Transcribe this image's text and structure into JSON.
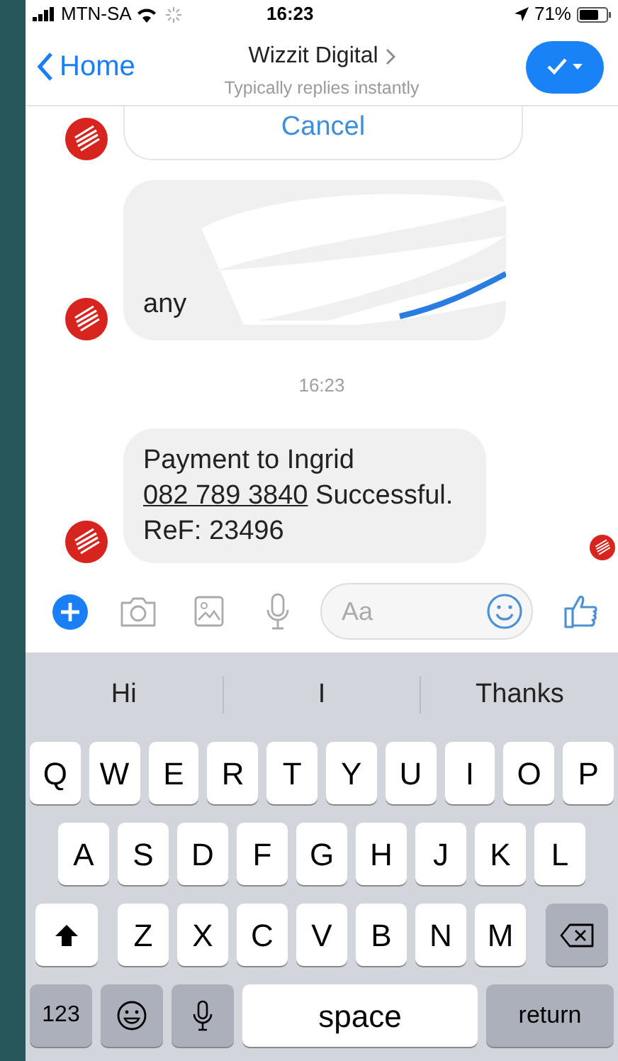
{
  "status_bar": {
    "carrier": "MTN-SA",
    "time": "16:23",
    "battery": "71%"
  },
  "header": {
    "back": "Home",
    "title": "Wizzit Digital",
    "subtitle": "Typically replies instantly"
  },
  "messages": [
    {
      "kind": "button",
      "text": "Cancel"
    },
    {
      "kind": "redacted",
      "text": "any"
    },
    {
      "kind": "timestamp",
      "text": "16:23"
    },
    {
      "kind": "text",
      "parts": [
        {
          "text": "Payment to Ingrid",
          "link": false
        },
        {
          "text": "082 789 3840",
          "link": true
        },
        {
          "text": "Successful. ReF: 23496",
          "link": false
        }
      ],
      "read": true
    }
  ],
  "composer": {
    "placeholder": "Aa"
  },
  "suggestions": [
    "Hi",
    "I",
    "Thanks"
  ],
  "keyboard": {
    "rows": [
      [
        "Q",
        "W",
        "E",
        "R",
        "T",
        "Y",
        "U",
        "I",
        "O",
        "P"
      ],
      [
        "A",
        "S",
        "D",
        "F",
        "G",
        "H",
        "J",
        "K",
        "L"
      ],
      [
        "Z",
        "X",
        "C",
        "V",
        "B",
        "N",
        "M"
      ]
    ],
    "numbers": "123",
    "space": "space",
    "return": "return"
  }
}
